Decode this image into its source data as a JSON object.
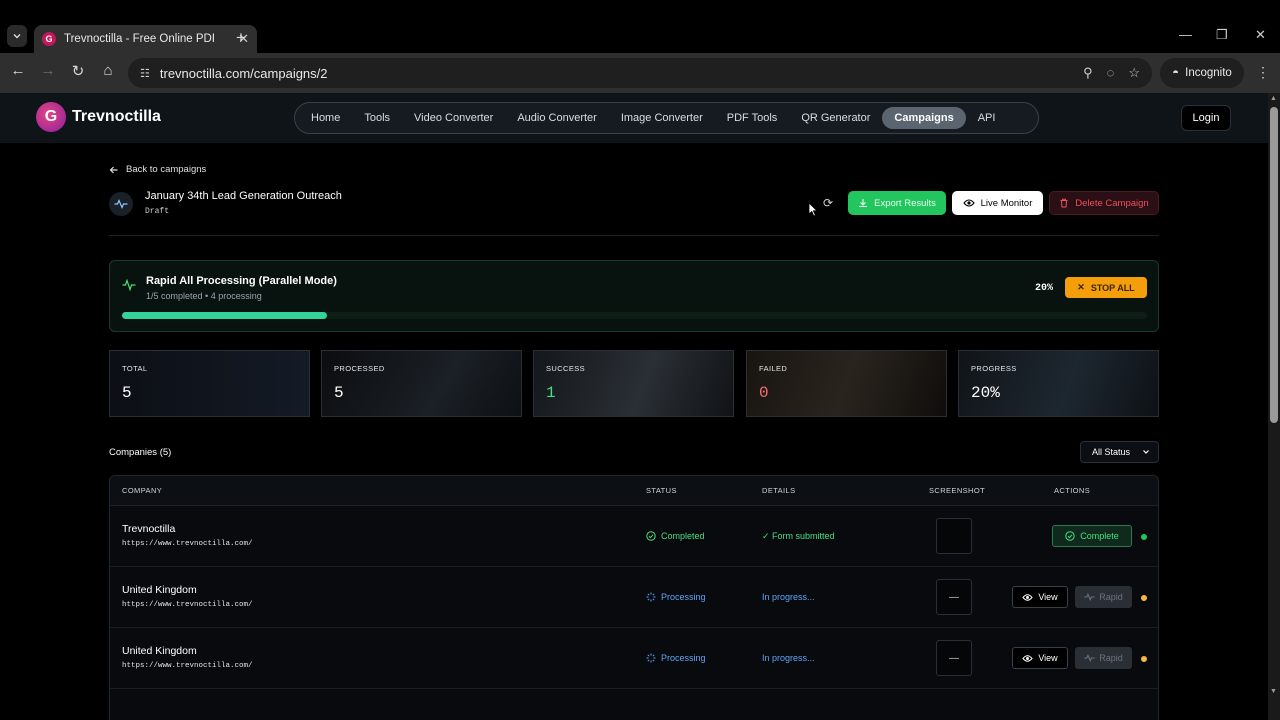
{
  "browser": {
    "tab_title": "Trevnoctilla - Free Online PDF E",
    "url": "trevnoctilla.com/campaigns/2",
    "profile_label": "Incognito"
  },
  "site": {
    "logo_letter": "G",
    "logo_text": "Trevnoctilla",
    "nav": [
      {
        "label": "Home",
        "active": false
      },
      {
        "label": "Tools",
        "active": false
      },
      {
        "label": "Video Converter",
        "active": false
      },
      {
        "label": "Audio Converter",
        "active": false
      },
      {
        "label": "Image Converter",
        "active": false
      },
      {
        "label": "PDF Tools",
        "active": false
      },
      {
        "label": "QR Generator",
        "active": false
      },
      {
        "label": "Campaigns",
        "active": true
      },
      {
        "label": "API",
        "active": false
      }
    ],
    "login_label": "Login"
  },
  "campaign": {
    "back_label": "Back to campaigns",
    "title": "January 34th Lead Generation Outreach",
    "status": "Draft",
    "export_label": "Export Results",
    "live_label": "Live Monitor",
    "delete_label": "Delete Campaign"
  },
  "rapid": {
    "title": "Rapid All Processing (Parallel Mode)",
    "subtitle": "1/5 completed • 4 processing",
    "percent_label": "20%",
    "progress": 0.2,
    "stop_label": "STOP ALL"
  },
  "stats": [
    {
      "label": "TOTAL",
      "value": "5",
      "tone": ""
    },
    {
      "label": "PROCESSED",
      "value": "5",
      "tone": ""
    },
    {
      "label": "SUCCESS",
      "value": "1",
      "tone": "green"
    },
    {
      "label": "FAILED",
      "value": "0",
      "tone": "red"
    },
    {
      "label": "PROGRESS",
      "value": "20%",
      "tone": ""
    }
  ],
  "companies": {
    "label": "Companies (5)",
    "filter_label": "All Status",
    "headers": {
      "company": "COMPANY",
      "status": "STATUS",
      "details": "DETAILS",
      "screenshot": "SCREENSHOT",
      "actions": "ACTIONS"
    },
    "rows": [
      {
        "name": "Trevnoctilla",
        "url": "https://www.trevnoctilla.com/",
        "status": "Completed",
        "details": "✓ Form submitted",
        "screenshot": "",
        "action": "Complete"
      },
      {
        "name": "United Kingdom",
        "url": "https://www.trevnoctilla.com/",
        "status": "Processing",
        "details": "In progress...",
        "screenshot": "—",
        "view": "View",
        "rapid": "Rapid"
      },
      {
        "name": "United Kingdom",
        "url": "https://www.trevnoctilla.com/",
        "status": "Processing",
        "details": "In progress...",
        "screenshot": "—",
        "view": "View",
        "rapid": "Rapid"
      }
    ]
  }
}
